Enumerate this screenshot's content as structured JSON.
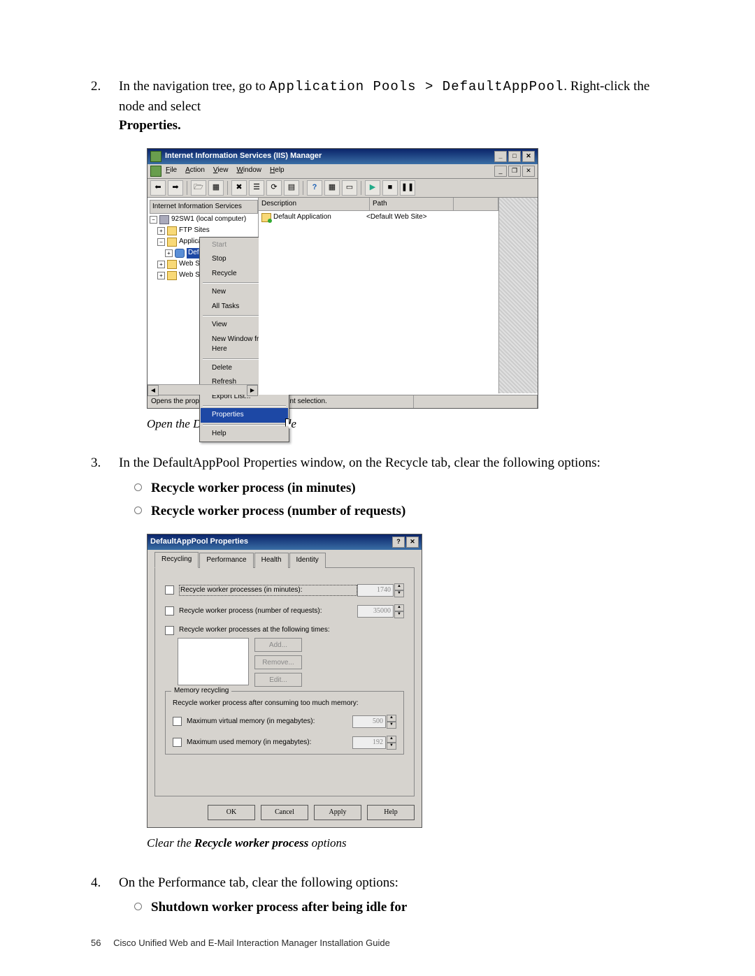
{
  "step2": {
    "num": "2.",
    "pre": "In the navigation tree, go to ",
    "path": "Application Pools > DefaultAppPool",
    "post": ". Right-click the node and select ",
    "bold": "Properties."
  },
  "iis": {
    "title": "Internet Information Services (IIS) Manager",
    "menus": {
      "file": "File",
      "action": "Action",
      "view": "View",
      "window": "Window",
      "help": "Help"
    },
    "tree": {
      "hdr": "Internet Information Services",
      "n0": "92SW1 (local computer)",
      "n1": "FTP Sites",
      "n2": "Application Pools",
      "n3": "DefaultAppPool",
      "n4": "Web Si",
      "n5": "Web Se"
    },
    "list": {
      "col_desc": "Description",
      "col_path": "Path",
      "row_desc": "Default Application",
      "row_path": "<Default Web Site>"
    },
    "ctx": {
      "start": "Start",
      "stop": "Stop",
      "recycle": "Recycle",
      "new": "New",
      "alltasks": "All Tasks",
      "view": "View",
      "newwin": "New Window from Here",
      "delete": "Delete",
      "refresh": "Refresh",
      "export": "Export List...",
      "properties": "Properties",
      "help": "Help"
    },
    "status": "Opens the properties dialog box for the current selection."
  },
  "caption1_a": "Open the DefaultAppPool node",
  "step3": {
    "num": "3.",
    "text": "In the DefaultAppPool Properties window, on the Recycle tab, clear the following options:",
    "b1": "Recycle worker process (in minutes)",
    "b2": "Recycle worker process (number of requests)"
  },
  "dlg": {
    "title": "DefaultAppPool Properties",
    "tabs": {
      "recycling": "Recycling",
      "performance": "Performance",
      "health": "Health",
      "identity": "Identity"
    },
    "opt1": "Recycle worker processes (in minutes):",
    "val1": "1740",
    "opt2": "Recycle worker process (number of requests):",
    "val2": "35000",
    "opt3": "Recycle worker processes at the following times:",
    "add": "Add...",
    "remove": "Remove...",
    "edit": "Edit...",
    "mem_legend": "Memory recycling",
    "mem_sub": "Recycle worker process after consuming too much memory:",
    "mem1": "Maximum virtual memory (in megabytes):",
    "mem1v": "500",
    "mem2": "Maximum used memory (in megabytes):",
    "mem2v": "192",
    "ok": "OK",
    "cancel": "Cancel",
    "apply": "Apply",
    "help": "Help"
  },
  "caption2_a": "Clear the ",
  "caption2_b": "Recycle worker process",
  "caption2_c": " options",
  "step4": {
    "num": "4.",
    "text": "On the Performance tab, clear the following options:",
    "b1": "Shutdown worker process after being idle for"
  },
  "footer": {
    "page": "56",
    "title": "Cisco Unified Web and E-Mail Interaction Manager Installation Guide"
  }
}
